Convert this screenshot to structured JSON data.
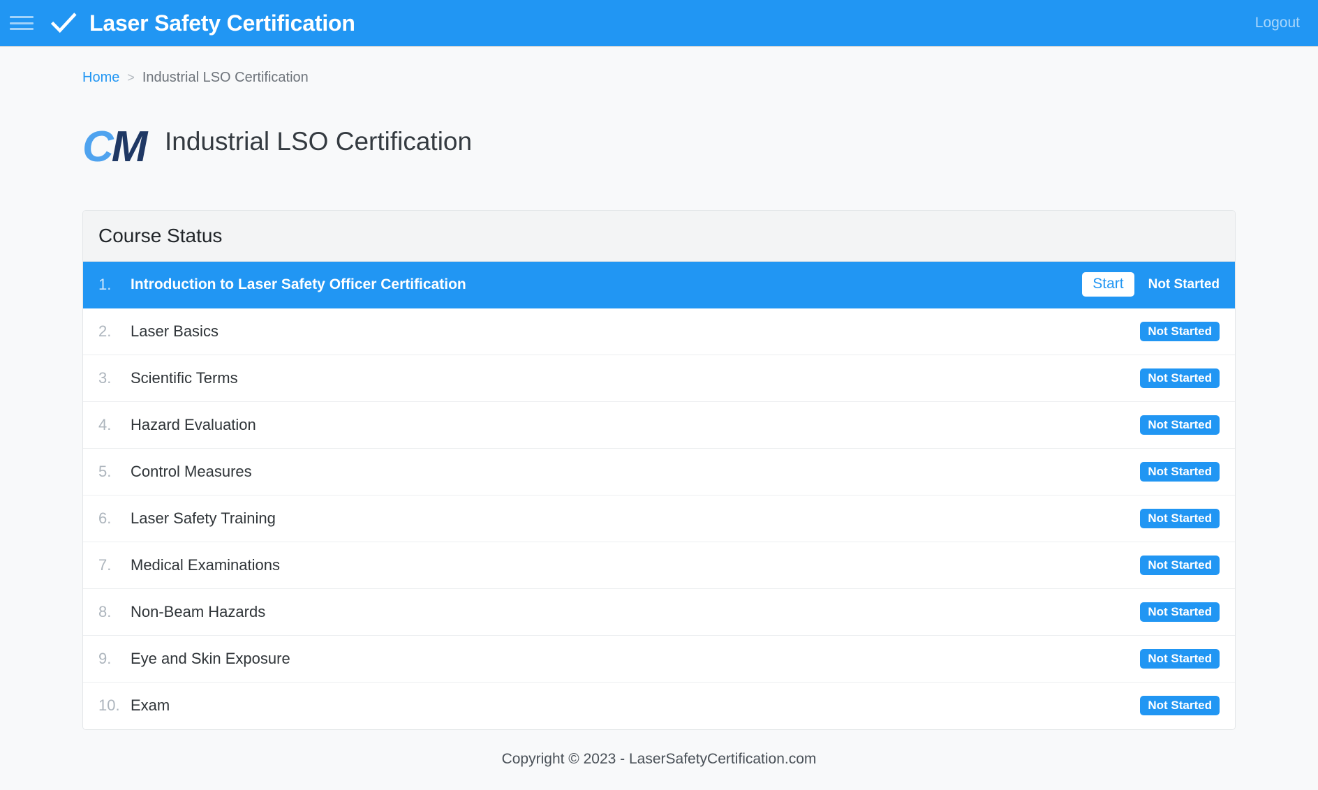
{
  "navbar": {
    "menu_icon": "hamburger-menu-icon",
    "logo_icon": "checkmark-icon",
    "brand_title": "Laser Safety Certification",
    "logout_label": "Logout"
  },
  "breadcrumb": {
    "home_label": "Home",
    "separator": ">",
    "current_label": "Industrial LSO Certification"
  },
  "page": {
    "logo_text_c": "C",
    "logo_text_m": "M",
    "title": "Industrial LSO Certification"
  },
  "card": {
    "header_title": "Course Status",
    "items": [
      {
        "num": "1.",
        "label": "Introduction to Laser Safety Officer Certification",
        "status": "Not Started",
        "active": true,
        "action_label": "Start"
      },
      {
        "num": "2.",
        "label": "Laser Basics",
        "status": "Not Started",
        "active": false,
        "action_label": ""
      },
      {
        "num": "3.",
        "label": "Scientific Terms",
        "status": "Not Started",
        "active": false,
        "action_label": ""
      },
      {
        "num": "4.",
        "label": "Hazard Evaluation",
        "status": "Not Started",
        "active": false,
        "action_label": ""
      },
      {
        "num": "5.",
        "label": "Control Measures",
        "status": "Not Started",
        "active": false,
        "action_label": ""
      },
      {
        "num": "6.",
        "label": "Laser Safety Training",
        "status": "Not Started",
        "active": false,
        "action_label": ""
      },
      {
        "num": "7.",
        "label": "Medical Examinations",
        "status": "Not Started",
        "active": false,
        "action_label": ""
      },
      {
        "num": "8.",
        "label": "Non-Beam Hazards",
        "status": "Not Started",
        "active": false,
        "action_label": ""
      },
      {
        "num": "9.",
        "label": "Eye and Skin Exposure",
        "status": "Not Started",
        "active": false,
        "action_label": ""
      },
      {
        "num": "10.",
        "label": "Exam",
        "status": "Not Started",
        "active": false,
        "action_label": ""
      }
    ]
  },
  "footer": {
    "copyright": "Copyright © 2023 - LaserSafetyCertification.com"
  },
  "colors": {
    "primary": "#2196f3",
    "page_bg": "#f8f9fa",
    "card_header_bg": "#f3f4f5",
    "logo_light_blue": "#4fa3ef",
    "logo_navy": "#1f3864"
  }
}
